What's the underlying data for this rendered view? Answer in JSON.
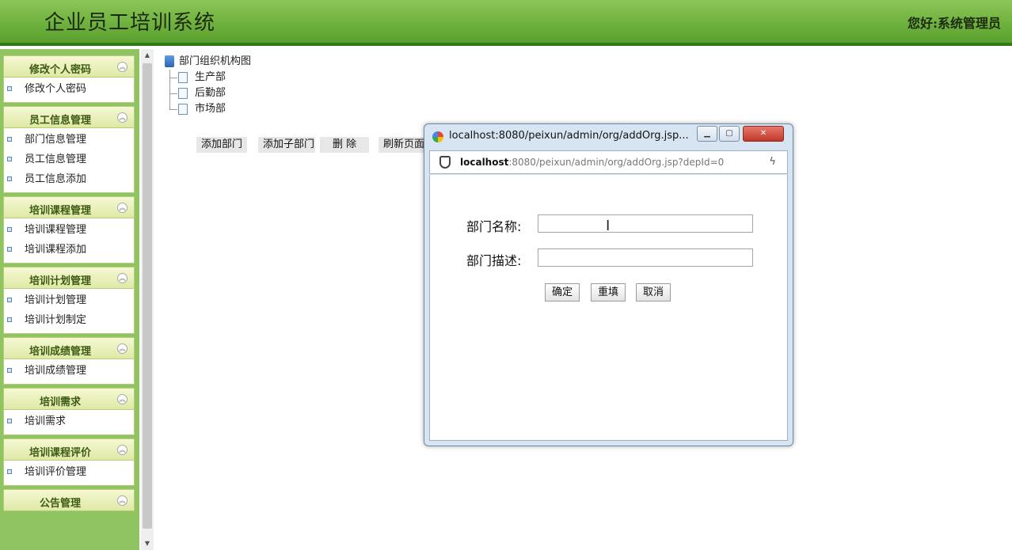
{
  "header": {
    "title": "企业员工培训系统",
    "greeting": "您好:系统管理员"
  },
  "sidebar": {
    "groups": [
      {
        "title": "修改个人密码",
        "items": [
          "修改个人密码"
        ]
      },
      {
        "title": "员工信息管理",
        "items": [
          "部门信息管理",
          "员工信息管理",
          "员工信息添加"
        ]
      },
      {
        "title": "培训课程管理",
        "items": [
          "培训课程管理",
          "培训课程添加"
        ]
      },
      {
        "title": "培训计划管理",
        "items": [
          "培训计划管理",
          "培训计划制定"
        ]
      },
      {
        "title": "培训成绩管理",
        "items": [
          "培训成绩管理"
        ]
      },
      {
        "title": "培训需求",
        "items": [
          "培训需求"
        ]
      },
      {
        "title": "培训课程评价",
        "items": [
          "培训评价管理"
        ]
      },
      {
        "title": "公告管理",
        "items": []
      }
    ]
  },
  "tree": {
    "root": "部门组织机构图",
    "nodes": [
      "生产部",
      "后勤部",
      "市场部"
    ]
  },
  "toolbar": {
    "add_dept": "添加部门",
    "add_sub": "添加子部门",
    "delete": "删 除",
    "refresh": "刷新页面"
  },
  "popup": {
    "window_title": "localhost:8080/peixun/admin/org/addOrg.jsp...",
    "url_host": "localhost",
    "url_rest": ":8080/peixun/admin/org/addOrg.jsp?depId=0",
    "form": {
      "name_label": "部门名称:",
      "name_value": "",
      "desc_label": "部门描述:",
      "desc_value": "",
      "confirm": "确定",
      "reset": "重填",
      "cancel": "取消"
    }
  }
}
